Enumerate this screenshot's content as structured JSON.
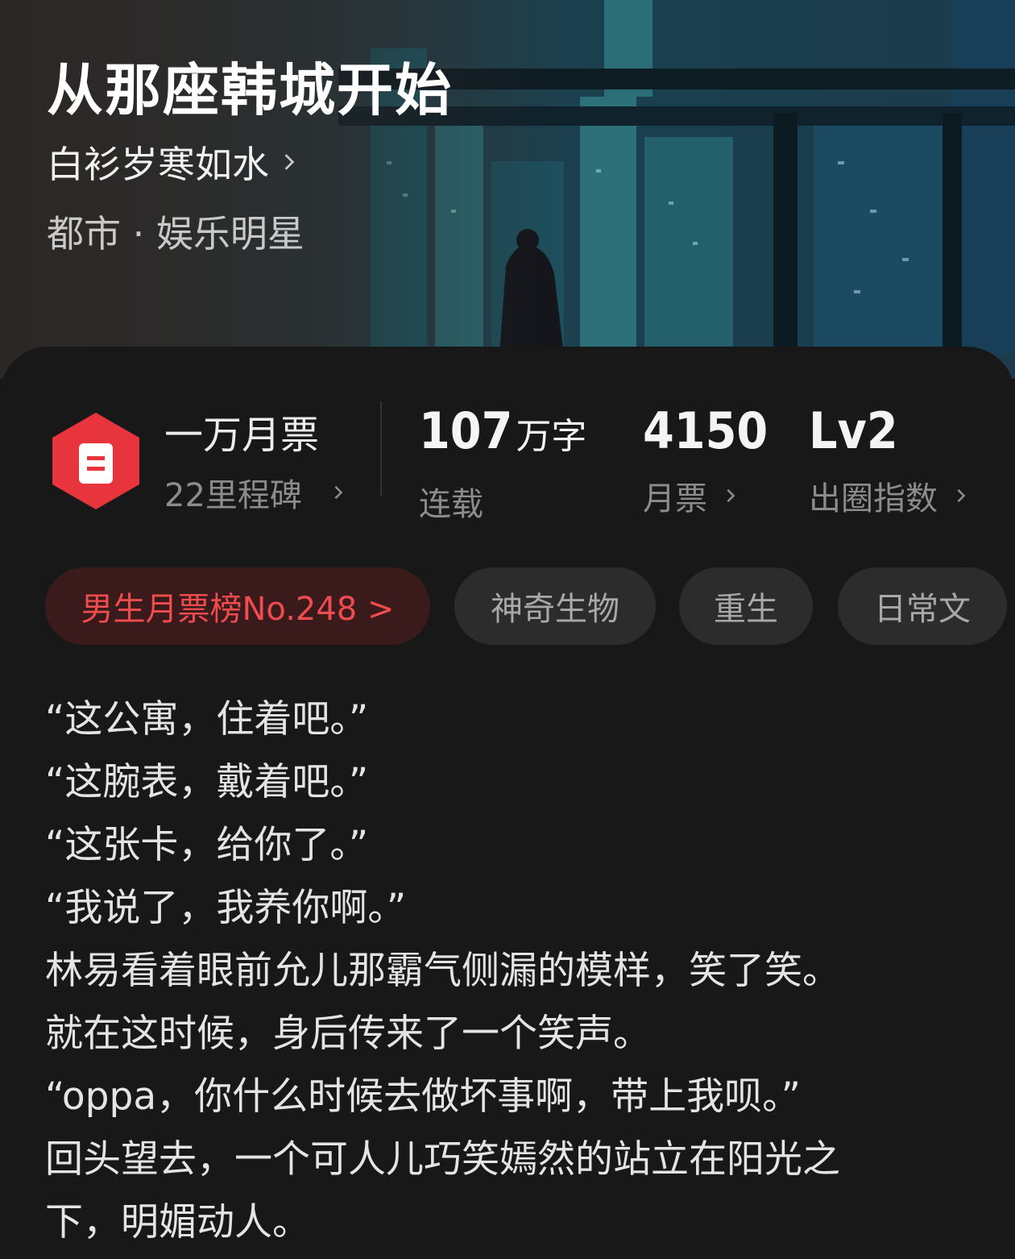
{
  "book": {
    "title": "从那座韩城开始",
    "author": "白衫岁寒如水",
    "genre": "都市 · 娱乐明星"
  },
  "stats": {
    "monthly_ticket_milestone": "一万月票",
    "milestones": "22里程碑",
    "word_count": "107",
    "word_count_unit": "万字",
    "status": "连载",
    "monthly_tickets": "4150",
    "monthly_tickets_label": "月票",
    "level": "Lv2",
    "level_label": "出圈指数"
  },
  "tags": [
    {
      "label": "男生月票榜No.248 >"
    },
    {
      "label": "神奇生物"
    },
    {
      "label": "重生"
    },
    {
      "label": "日常文"
    }
  ],
  "synopsis": [
    "“这公寓，住着吧。”",
    "“这腕表，戴着吧。”",
    "“这张卡，给你了。”",
    "“我说了，我养你啊。”",
    "林易看着眼前允儿那霸气侧漏的模样，笑了笑。",
    "就在这时候，身后传来了一个笑声。",
    "“oppa，你什么时候去做坏事啊，带上我呗。”",
    "回头望去，一个可人儿巧笑嫣然的站立在阳光之",
    "下，明媚动人。"
  ],
  "colors": {
    "accent_red": "#ef4c4f",
    "badge_red": "#e8353d",
    "background": "#181818"
  }
}
